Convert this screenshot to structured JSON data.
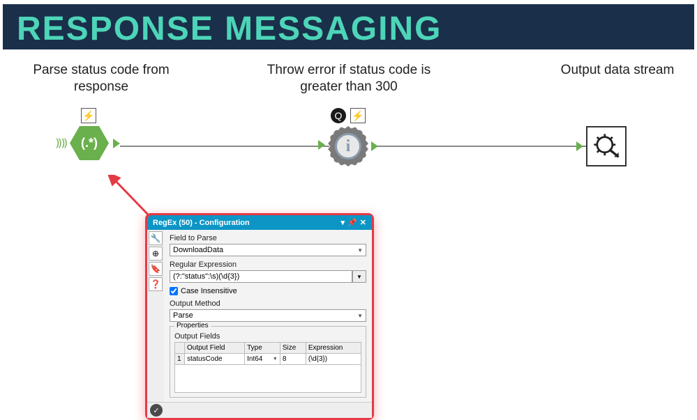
{
  "header": {
    "title": "RESPONSE MESSAGING"
  },
  "workflow": {
    "node1": {
      "label": "Parse status code from response",
      "icon_text": "(.*)"
    },
    "node2": {
      "label": "Throw error if status code is greater than 300",
      "icon_text": "i"
    },
    "node3": {
      "label": "Output data stream"
    }
  },
  "panel": {
    "title": "RegEx (50) - Configuration",
    "field_to_parse_label": "Field to Parse",
    "field_to_parse_value": "DownloadData",
    "regex_label": "Regular Expression",
    "regex_value": "(?:\"status\":\\s)(\\d{3})",
    "case_insensitive_label": "Case Insensitive",
    "case_insensitive_checked": true,
    "output_method_label": "Output Method",
    "output_method_value": "Parse",
    "properties_label": "Properties",
    "output_fields_label": "Output Fields",
    "columns": {
      "num": "",
      "output_field": "Output Field",
      "type": "Type",
      "size": "Size",
      "expression": "Expression"
    },
    "rows": [
      {
        "num": "1",
        "output_field": "statusCode",
        "type": "Int64",
        "size": "8",
        "expression": "(\\d{3})"
      }
    ]
  }
}
